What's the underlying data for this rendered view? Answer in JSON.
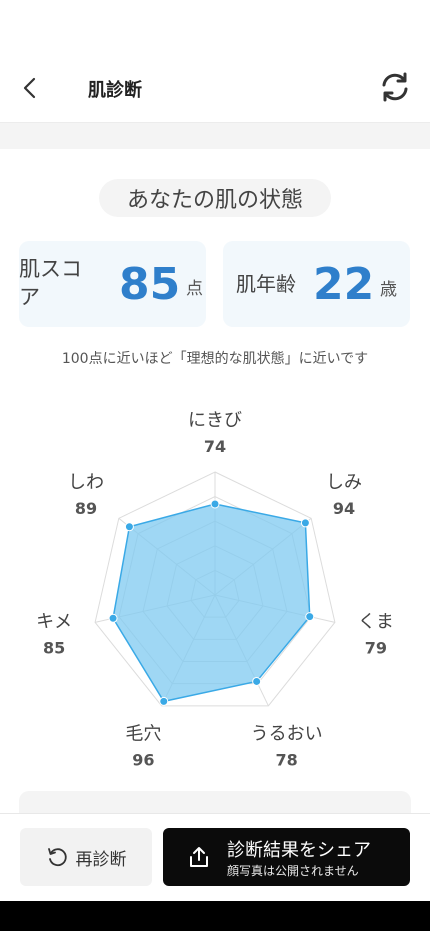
{
  "header": {
    "title": "肌診断"
  },
  "section": {
    "title": "あなたの肌の状態"
  },
  "skin_score": {
    "label": "肌スコア",
    "value": "85",
    "unit": "点"
  },
  "skin_age": {
    "label": "肌年齢",
    "value": "22",
    "unit": "歳"
  },
  "note": "100点に近いほど「理想的な肌状態」に近いです",
  "radar": {
    "max": 100,
    "fill_color": "#7fcaf0",
    "point_color": "#3aa9e6",
    "axes": [
      {
        "label": "にきび",
        "value": 74
      },
      {
        "label": "しみ",
        "value": 94
      },
      {
        "label": "くま",
        "value": 79
      },
      {
        "label": "うるおい",
        "value": 78
      },
      {
        "label": "毛穴",
        "value": 96
      },
      {
        "label": "キメ",
        "value": 85
      },
      {
        "label": "しわ",
        "value": 89
      }
    ]
  },
  "actions": {
    "rediagnose_label": "再診断",
    "share_label": "診断結果をシェア",
    "share_sub": "顔写真は公開されません"
  },
  "icons": {
    "back": "chevron-left-icon",
    "refresh": "refresh-icon",
    "rediagnose": "history-icon",
    "share": "share-icon"
  }
}
